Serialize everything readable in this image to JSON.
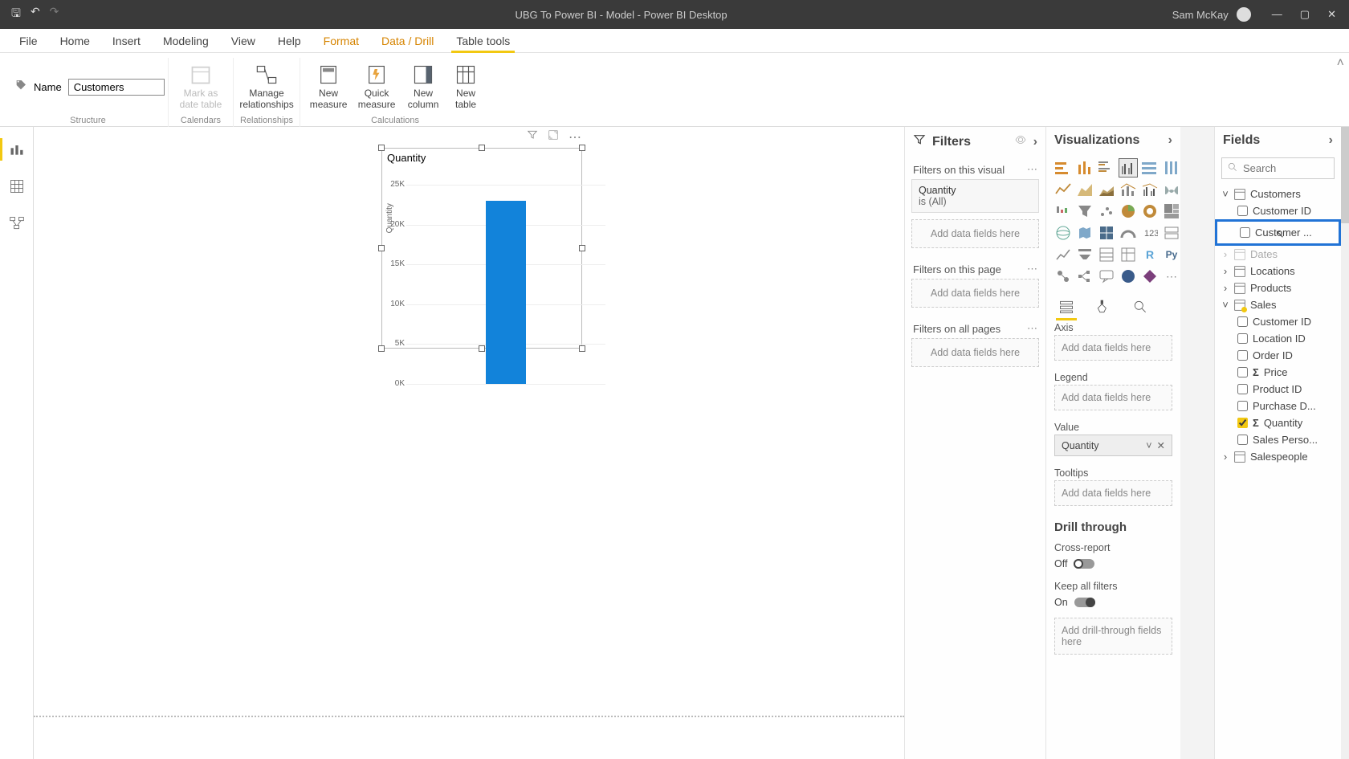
{
  "titlebar": {
    "title": "UBG To Power BI - Model - Power BI Desktop",
    "user": "Sam McKay"
  },
  "ribbon_tabs": [
    "File",
    "Home",
    "Insert",
    "Modeling",
    "View",
    "Help",
    "Format",
    "Data / Drill",
    "Table tools"
  ],
  "ribbon_tabs_highlighted": [
    "Format",
    "Data / Drill"
  ],
  "ribbon_active_tab": "Table tools",
  "ribbon": {
    "name_label": "Name",
    "name_value": "Customers",
    "mark_date": "Mark as date table",
    "manage_rel": "Manage relationships",
    "new_measure": "New measure",
    "quick_measure": "Quick measure",
    "new_column": "New column",
    "new_table": "New table",
    "group_structure": "Structure",
    "group_calendars": "Calendars",
    "group_relationships": "Relationships",
    "group_calculations": "Calculations"
  },
  "visual": {
    "title": "Quantity",
    "ylabel": "Quantity"
  },
  "chart_data": {
    "type": "bar",
    "categories": [
      ""
    ],
    "values": [
      23000
    ],
    "title": "Quantity",
    "xlabel": "",
    "ylabel": "Quantity",
    "ylim": [
      0,
      25000
    ],
    "yticks": [
      0,
      5000,
      10000,
      15000,
      20000,
      25000
    ],
    "ytick_labels": [
      "0K",
      "5K",
      "10K",
      "15K",
      "20K",
      "25K"
    ]
  },
  "filters": {
    "title": "Filters",
    "on_visual": "Filters on this visual",
    "card_name": "Quantity",
    "card_desc": "is (All)",
    "on_page": "Filters on this page",
    "on_all": "Filters on all pages",
    "add_here": "Add data fields here"
  },
  "viz": {
    "title": "Visualizations",
    "axis": "Axis",
    "legend": "Legend",
    "value": "Value",
    "value_pill": "Quantity",
    "tooltips": "Tooltips",
    "add_here": "Add data fields here",
    "drill": "Drill through",
    "cross": "Cross-report",
    "off": "Off",
    "keep": "Keep all filters",
    "on": "On",
    "drill_add": "Add drill-through fields here"
  },
  "fields": {
    "title": "Fields",
    "search_ph": "Search",
    "tables": {
      "customers": "Customers",
      "customers_fields": [
        "Customer ID",
        "Customer ..."
      ],
      "dates": "Dates",
      "locations": "Locations",
      "products": "Products",
      "sales": "Sales",
      "sales_fields": [
        {
          "name": "Customer ID",
          "sigma": false,
          "checked": false
        },
        {
          "name": "Location ID",
          "sigma": false,
          "checked": false
        },
        {
          "name": "Order ID",
          "sigma": false,
          "checked": false
        },
        {
          "name": "Price",
          "sigma": true,
          "checked": false
        },
        {
          "name": "Product ID",
          "sigma": false,
          "checked": false
        },
        {
          "name": "Purchase D...",
          "sigma": false,
          "checked": false
        },
        {
          "name": "Quantity",
          "sigma": true,
          "checked": true
        },
        {
          "name": "Sales Perso...",
          "sigma": false,
          "checked": false
        }
      ],
      "salespeople": "Salespeople"
    }
  }
}
